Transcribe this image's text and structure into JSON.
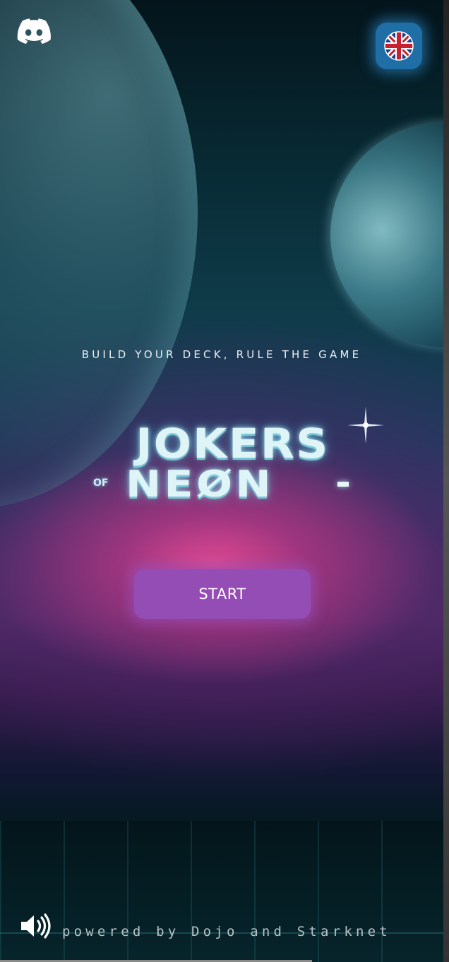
{
  "header": {
    "discord_icon": "discord-icon",
    "language_flag": "uk-flag-icon"
  },
  "hero": {
    "tagline": "BUILD YOUR DECK, RULE THE GAME",
    "logo": {
      "line1": "JOKERS",
      "of": "OF",
      "line2": "NEØN"
    },
    "start_label": "START"
  },
  "footer": {
    "sound_icon": "speaker-volume-icon",
    "powered_by": "powered by Dojo and Starknet"
  },
  "colors": {
    "start_button": "#944db5",
    "flag_button": "#1f6ea6",
    "glow_pink": "#ec4e96"
  }
}
